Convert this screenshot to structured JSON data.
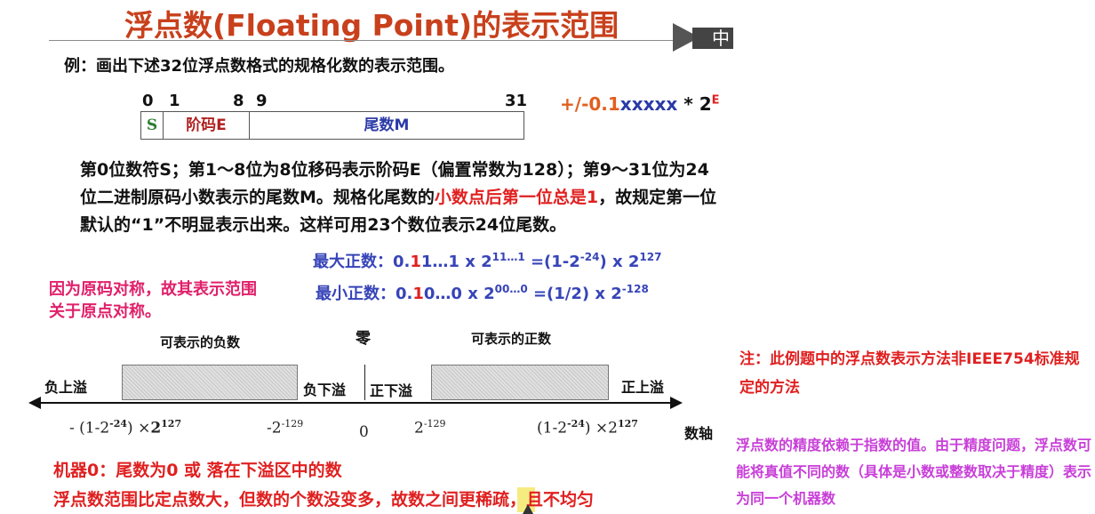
{
  "title": "浮点数(Floating Point)的表示范围",
  "badge": "中",
  "example": "例：画出下述32位浮点数格式的规格化数的表示范围。",
  "bit_labels": [
    "0",
    "1",
    "8",
    "9",
    "31"
  ],
  "format": {
    "s": "S",
    "e": "阶码E",
    "m": "尾数M"
  },
  "formula": {
    "sign": "+/-0.1",
    "x": "xxxxx",
    "times": " * 2",
    "exp": "E"
  },
  "paragraph": {
    "p1": "第0位数符S；第1～8位为8位移码表示阶码E（偏置常数为128）；第9～31位为24位二进制原码小数表示的尾数M。规格化尾数的",
    "p2": "小数点后第一位总是1",
    "p3": "，故规定第一位默认的“1”不明显表示出来。这样可用23个数位表示24位尾数。"
  },
  "max_pos": {
    "label": "最大正数：0.",
    "one": "1",
    "rest": "1…1 x 2",
    "exp1": "11…1",
    "eq": "  =(1-2",
    "exp2": "-24",
    "tail": ") x 2",
    "exp3": "127"
  },
  "min_pos": {
    "label": "最小正数：0.",
    "one": "1",
    "rest": "0…0 x 2",
    "exp1": "00…0",
    "eq": "  =(1/2) x 2",
    "exp2": "-128"
  },
  "symmetric_note": "因为原码对称，故其表示范围关于原点对称。",
  "number_line": {
    "neg_label": "可表示的负数",
    "pos_label": "可表示的正数",
    "zero": "零",
    "neg_overflow": "负上溢",
    "neg_underflow": "负下溢",
    "pos_underflow": "正下溢",
    "pos_overflow": "正上溢",
    "axis_name": "数轴",
    "ticks": {
      "t1a": "- (1-2",
      "t1b": "-24",
      "t1c": ") ×",
      "t1d": "2",
      "t1e": "127",
      "t2a": "-2",
      "t2b": "-129",
      "t3": "0",
      "t4a": "2",
      "t4b": "-129",
      "t5a": "(1-2",
      "t5b": "-24",
      "t5c": ") ×2",
      "t5d": "127"
    }
  },
  "machine_zero": "机器0：尾数为0 或 落在下溢区中的数",
  "range_note": "浮点数范围比定点数大，但数的个数没变多，故数之间更稀疏，且不均匀",
  "side_note": "注：此例题中的浮点数表示方法非IEEE754标准规定的方法",
  "precision_note": "浮点数的精度依赖于指数的值。由于精度问题，浮点数可能将真值不同的数（具体是小数或整数取决于精度）表示为同一个机器数",
  "colors": {
    "title": "#c8401c",
    "red": "#e02020",
    "blue": "#2b3aa8",
    "pink": "#e0206a",
    "purple": "#c83fd8",
    "green": "#2e7d32"
  }
}
